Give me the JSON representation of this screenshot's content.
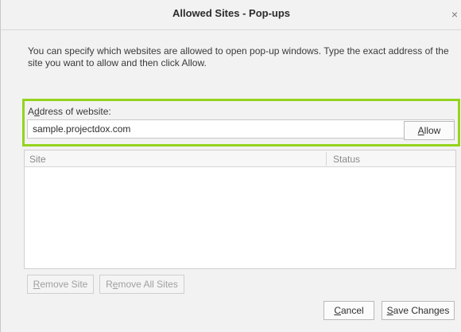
{
  "dialog": {
    "title": "Allowed Sites - Pop-ups",
    "close_glyph": "×",
    "description": "You can specify which websites are allowed to open pop-up windows. Type the exact address of the site you want to allow and then click Allow."
  },
  "address": {
    "label_accesskey": "d",
    "label_rest": "dress of website:",
    "label_prefix": "A",
    "value": "sample.projectdox.com"
  },
  "buttons": {
    "allow_key": "A",
    "allow_rest": "llow",
    "remove_site_key": "R",
    "remove_site_rest": "emove Site",
    "remove_all_prefix": "R",
    "remove_all_key": "e",
    "remove_all_rest": "move All Sites",
    "cancel_key": "C",
    "cancel_rest": "ancel",
    "save_key": "S",
    "save_rest": "ave Changes"
  },
  "table": {
    "columns": [
      "Site",
      "Status"
    ],
    "rows": []
  },
  "colors": {
    "highlight": "#95d31e"
  },
  "icons": {
    "close": "close-icon"
  }
}
